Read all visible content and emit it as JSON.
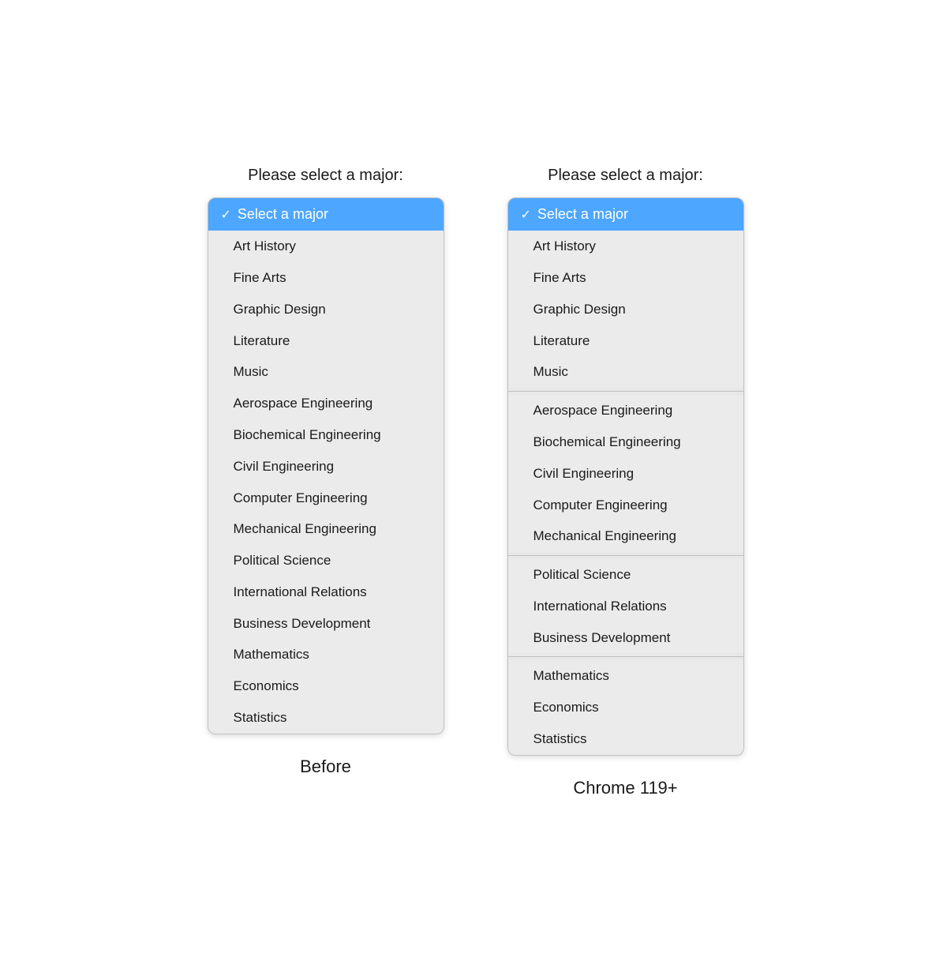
{
  "left": {
    "label": "Please select a major:",
    "selected": "Select a major",
    "caption": "Before",
    "items": [
      {
        "label": "Art History"
      },
      {
        "label": "Fine Arts"
      },
      {
        "label": "Graphic Design"
      },
      {
        "label": "Literature"
      },
      {
        "label": "Music"
      },
      {
        "label": "Aerospace Engineering"
      },
      {
        "label": "Biochemical Engineering"
      },
      {
        "label": "Civil Engineering"
      },
      {
        "label": "Computer Engineering"
      },
      {
        "label": "Mechanical Engineering"
      },
      {
        "label": "Political Science"
      },
      {
        "label": "International Relations"
      },
      {
        "label": "Business Development"
      },
      {
        "label": "Mathematics"
      },
      {
        "label": "Economics"
      },
      {
        "label": "Statistics"
      }
    ]
  },
  "right": {
    "label": "Please select a major:",
    "selected": "Select a major",
    "caption": "Chrome 119+",
    "groups": [
      {
        "items": [
          {
            "label": "Art History"
          },
          {
            "label": "Fine Arts"
          },
          {
            "label": "Graphic Design"
          },
          {
            "label": "Literature"
          },
          {
            "label": "Music"
          }
        ]
      },
      {
        "items": [
          {
            "label": "Aerospace Engineering"
          },
          {
            "label": "Biochemical Engineering"
          },
          {
            "label": "Civil Engineering"
          },
          {
            "label": "Computer Engineering"
          },
          {
            "label": "Mechanical Engineering"
          }
        ]
      },
      {
        "items": [
          {
            "label": "Political Science"
          },
          {
            "label": "International Relations"
          },
          {
            "label": "Business Development"
          }
        ]
      },
      {
        "items": [
          {
            "label": "Mathematics"
          },
          {
            "label": "Economics"
          },
          {
            "label": "Statistics"
          }
        ]
      }
    ]
  },
  "icons": {
    "checkmark": "✓"
  }
}
